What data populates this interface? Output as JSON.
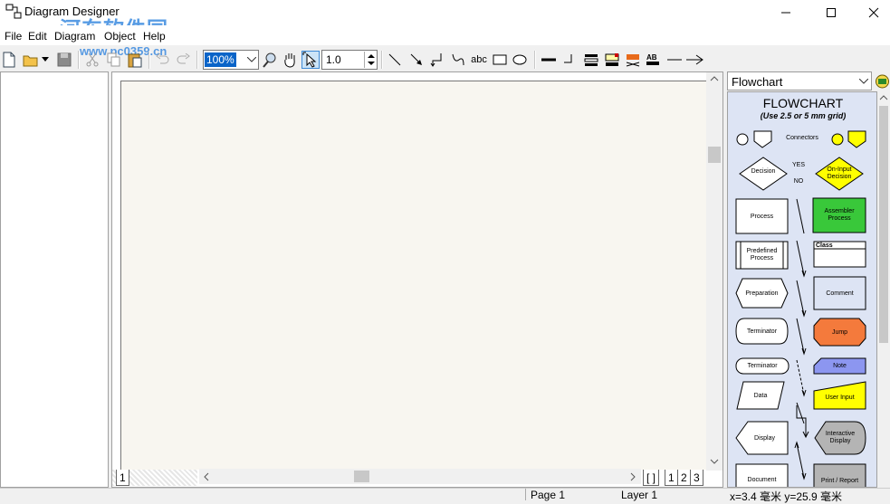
{
  "window": {
    "title": "Diagram Designer",
    "watermark": "河东软件园",
    "watermark_url": "www.pc0359.cn"
  },
  "menu": [
    "File",
    "Edit",
    "Diagram",
    "Object",
    "Help"
  ],
  "toolbar": {
    "zoom": "100%",
    "line_width": "1.0",
    "text_tool": "abc"
  },
  "sheet_tabs": {
    "left": "1",
    "right": [
      "[ ]",
      "1",
      "2",
      "3"
    ]
  },
  "library": {
    "selected": "Flowchart",
    "title": "FLOWCHART",
    "subtitle": "(Use 2.5 or 5 mm grid)",
    "labels": {
      "connectors": "Connectors",
      "decision": "Decision",
      "yes": "YES",
      "no": "NO",
      "on_input_decision": "On-Input Decision",
      "process": "Process",
      "assembler_process": "Assembler Process",
      "predefined_process": "Predefined Process",
      "class": "Class",
      "preparation": "Preparation",
      "comment": "Comment",
      "terminator1": "Terminator",
      "jump": "Jump",
      "terminator2": "Terminator",
      "note": "Note",
      "data": "Data",
      "user_input": "User Input",
      "display": "Display",
      "interactive_display": "Interactive Display",
      "document": "Document",
      "print_report": "Print / Report"
    },
    "colors": {
      "yellow": "#ffff00",
      "green": "#39c83a",
      "orange": "#f47a3c",
      "note": "#8c96f0",
      "gray": "#b4b4b4"
    }
  },
  "status": {
    "page": "Page 1",
    "layer": "Layer 1",
    "coords": "x=3.4 毫米  y=25.9 毫米"
  }
}
